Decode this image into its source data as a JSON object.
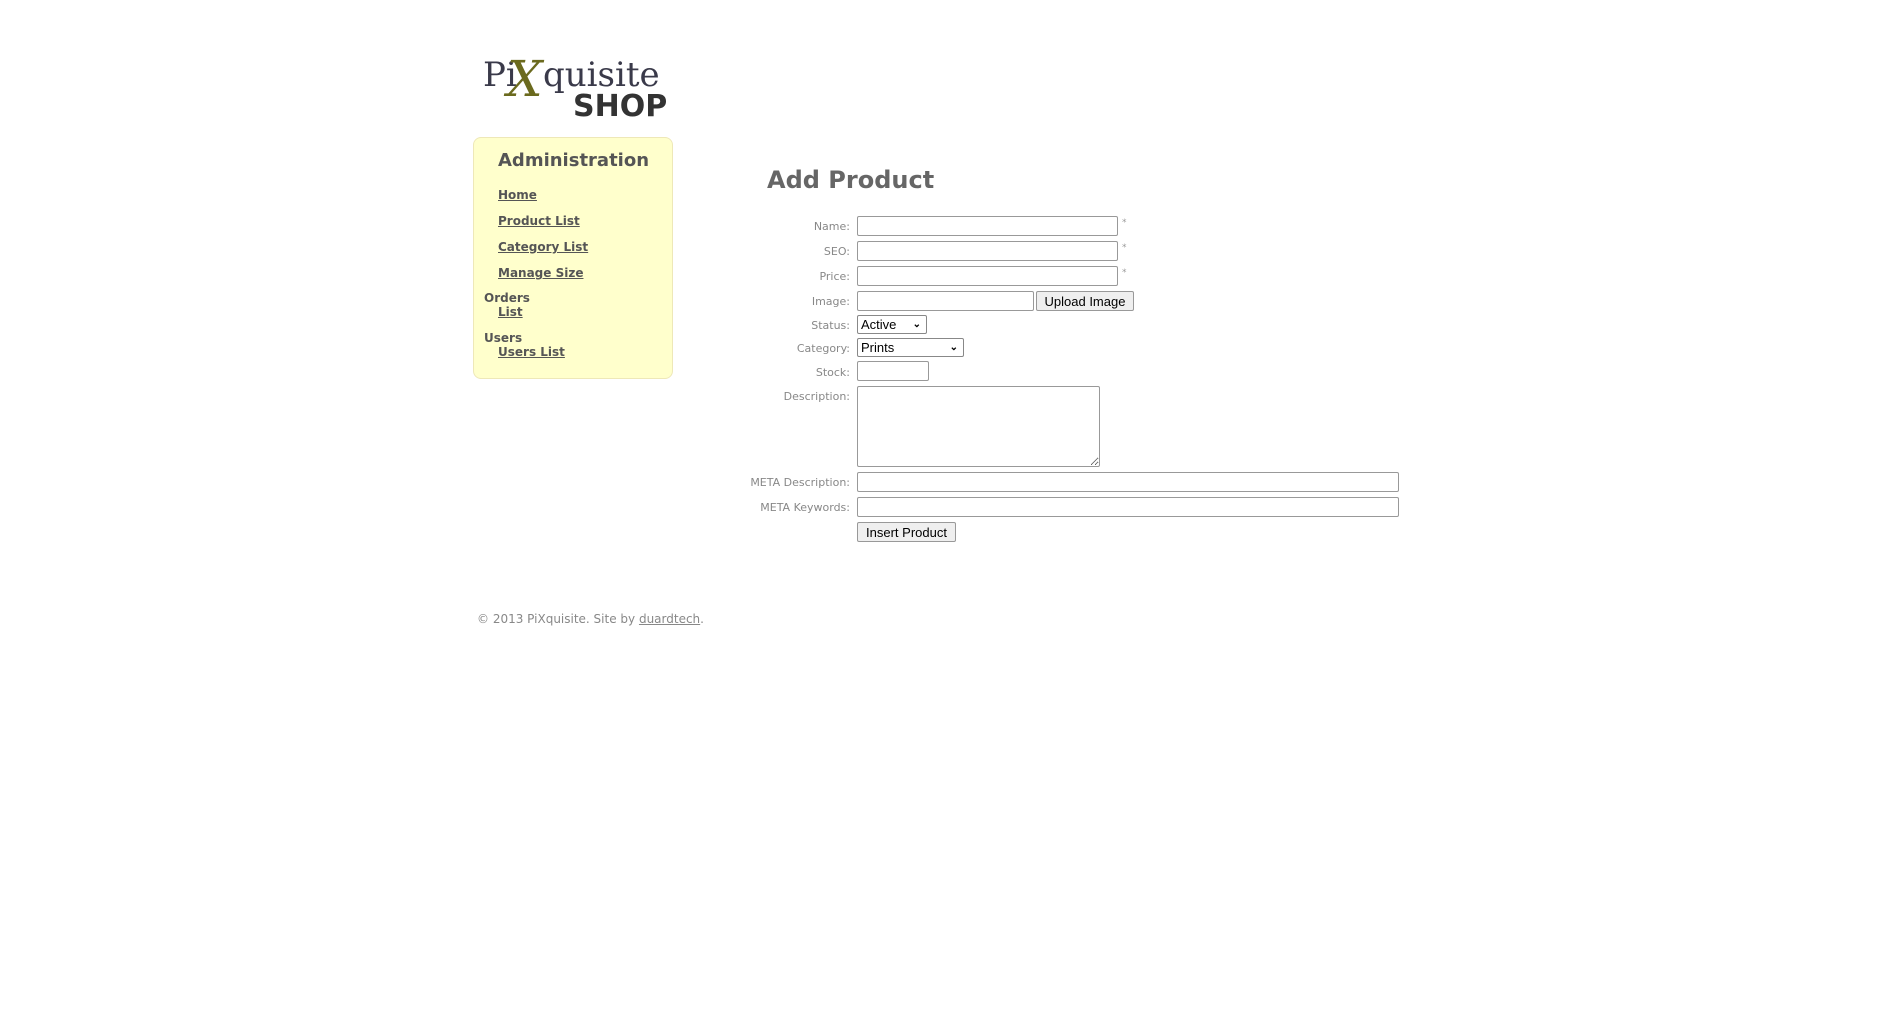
{
  "logo": {
    "text_main": "PiXquisite",
    "text_sub": "SHOP"
  },
  "sidebar": {
    "title": "Administration",
    "links": [
      "Home",
      "Product List",
      "Category List",
      "Manage Size"
    ],
    "orders": {
      "heading": "Orders",
      "links": [
        "List"
      ]
    },
    "users": {
      "heading": "Users",
      "links": [
        "Users List"
      ]
    }
  },
  "form": {
    "title": "Add Product",
    "required_mark": "*",
    "labels": {
      "name": "Name:",
      "seo": "SEO:",
      "price": "Price:",
      "image": "Image:",
      "status": "Status:",
      "category": "Category:",
      "stock": "Stock:",
      "description": "Description:",
      "meta_description": "META Description:",
      "meta_keywords": "META Keywords:"
    },
    "values": {
      "name": "",
      "seo": "",
      "price": "",
      "image": "",
      "stock": "",
      "description": "",
      "meta_description": "",
      "meta_keywords": ""
    },
    "status_selected": "Active",
    "category_selected": "Prints",
    "upload_button": "Upload Image",
    "submit_button": "Insert Product"
  },
  "footer": {
    "text": "© 2013 PiXquisite. Site by ",
    "link": "duardtech",
    "end": "."
  }
}
